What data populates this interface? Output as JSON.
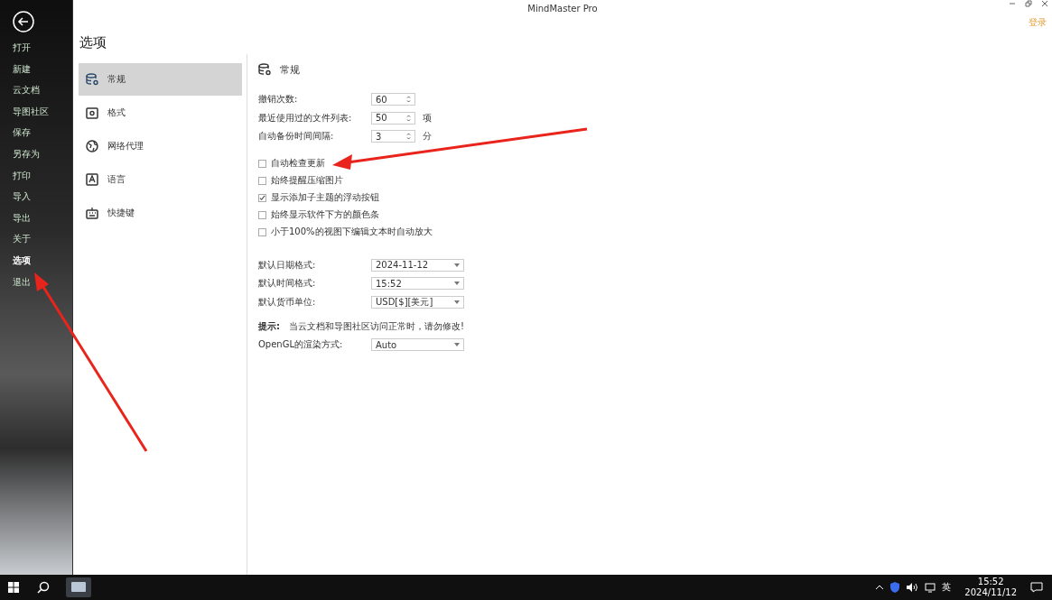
{
  "window": {
    "title": "MindMaster Pro",
    "login": "登录"
  },
  "file_menu": [
    {
      "label": "打开",
      "selected": false
    },
    {
      "label": "新建",
      "selected": false
    },
    {
      "label": "云文档",
      "selected": false
    },
    {
      "label": "导图社区",
      "selected": false
    },
    {
      "label": "保存",
      "selected": false
    },
    {
      "label": "另存为",
      "selected": false
    },
    {
      "label": "打印",
      "selected": false
    },
    {
      "label": "导入",
      "selected": false
    },
    {
      "label": "导出",
      "selected": false
    },
    {
      "label": "关于",
      "selected": false
    },
    {
      "label": "选项",
      "selected": true
    },
    {
      "label": "退出",
      "selected": false
    }
  ],
  "page_title": "选项",
  "categories": [
    {
      "label": "常规",
      "kind": "general",
      "selected": true
    },
    {
      "label": "格式",
      "kind": "format",
      "selected": false
    },
    {
      "label": "网络代理",
      "kind": "network",
      "selected": false
    },
    {
      "label": "语言",
      "kind": "language",
      "selected": false
    },
    {
      "label": "快捷键",
      "kind": "keyboard",
      "selected": false
    }
  ],
  "section_title": "常规",
  "spinners": [
    {
      "label": "撤销次数:",
      "value": "60"
    },
    {
      "label": "最近使用过的文件列表:",
      "value": "50",
      "unit": "项"
    },
    {
      "label": "自动备份时间间隔:",
      "value": "3",
      "unit": "分"
    }
  ],
  "checkboxes": [
    {
      "label": "自动检查更新",
      "checked": false
    },
    {
      "label": "始终提醒压缩图片",
      "checked": false
    },
    {
      "label": "显示添加子主题的浮动按钮",
      "checked": true
    },
    {
      "label": "始终显示软件下方的颜色条",
      "checked": false
    },
    {
      "label": "小于100%的视图下编辑文本时自动放大",
      "checked": false
    }
  ],
  "dropdowns": [
    {
      "label": "默认日期格式:",
      "value": "2024-11-12"
    },
    {
      "label": "默认时间格式:",
      "value": "15:52"
    },
    {
      "label": "默认货币单位:",
      "value": "USD[$][美元]"
    }
  ],
  "hint": {
    "label": "提示:",
    "text": "当云文档和导图社区访问正常时，请勿修改!"
  },
  "render": {
    "label": "OpenGL的渲染方式:",
    "value": "Auto"
  },
  "taskbar": {
    "ime": "英",
    "time": "15:52",
    "date": "2024/11/12"
  }
}
